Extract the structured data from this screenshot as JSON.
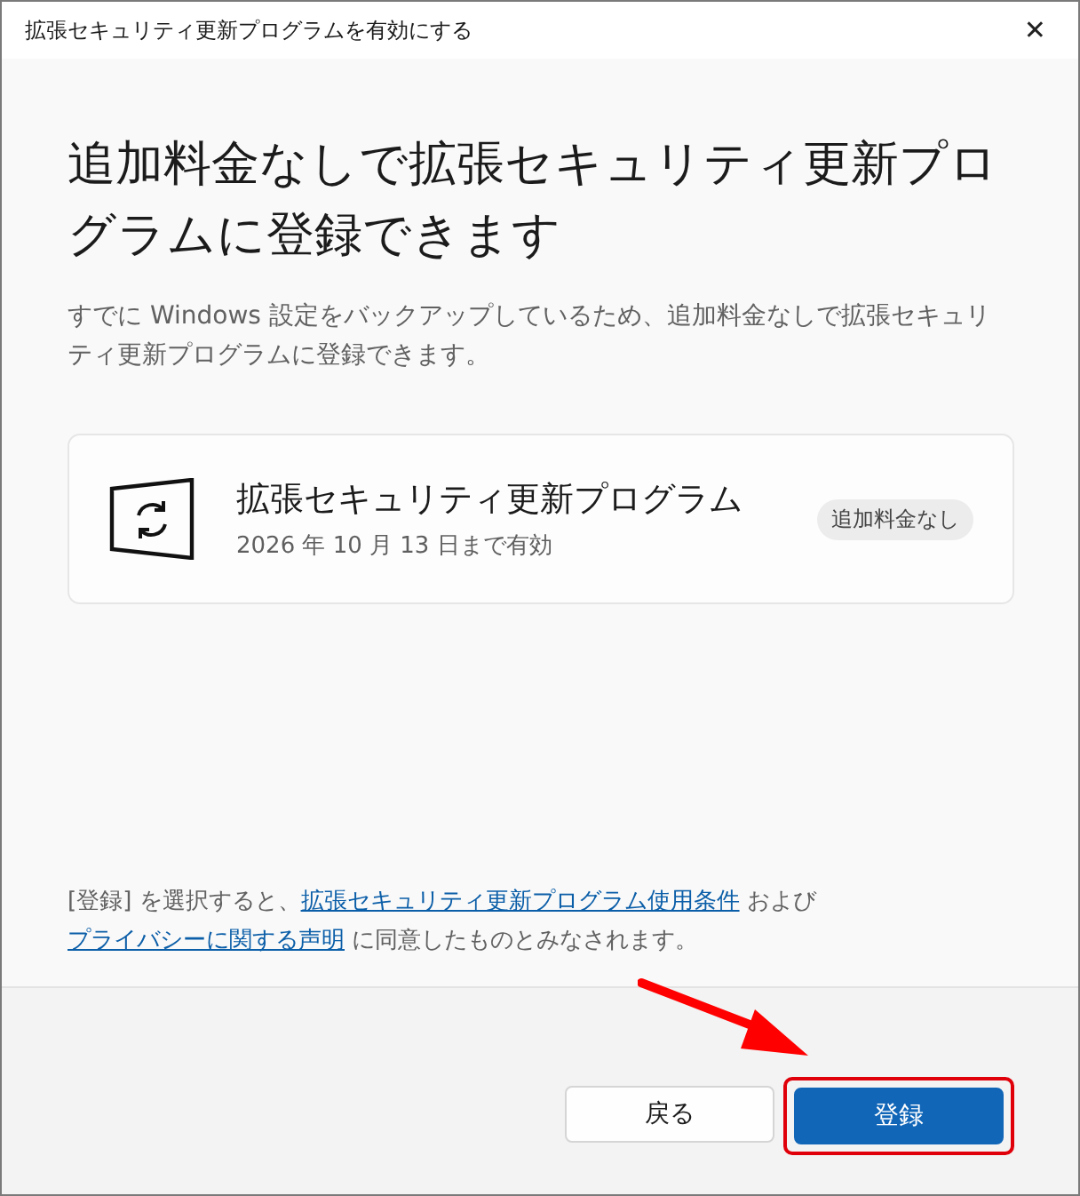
{
  "window": {
    "title": "拡張セキュリティ更新プログラムを有効にする",
    "close": "✕"
  },
  "heading": "追加料金なしで拡張セキュリティ更新プログラムに登録できます",
  "description": "すでに Windows 設定をバックアップしているため、追加料金なしで拡張セキュリティ更新プログラムに登録できます。",
  "card": {
    "title": "拡張セキュリティ更新プログラム",
    "subtitle": "2026 年 10 月 13 日まで有効",
    "badge": "追加料金なし"
  },
  "consent": [
    {
      "kind": "text",
      "text": "[登録] を選択すると、"
    },
    {
      "kind": "link",
      "text": "拡張セキュリティ更新プログラム使用条件"
    },
    {
      "kind": "text",
      "text": " および "
    },
    {
      "kind": "link",
      "text": "プライバシーに関する声明"
    },
    {
      "kind": "text",
      "text": " に同意したものとみなされます。"
    }
  ],
  "buttons": [
    {
      "label": "戻る",
      "kind": "secondary"
    },
    {
      "label": "登録",
      "kind": "primary",
      "highlighted": true
    }
  ]
}
